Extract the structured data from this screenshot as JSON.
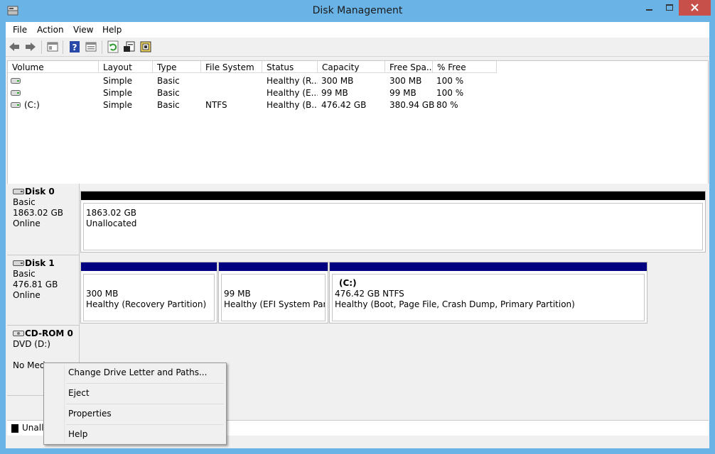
{
  "window": {
    "title": "Disk Management",
    "icon": "disk-management-icon"
  },
  "menu": [
    "File",
    "Action",
    "View",
    "Help"
  ],
  "toolbar": {
    "buttons": [
      "back-icon",
      "forward-icon",
      "console-tree-icon",
      "help-icon",
      "properties-list-icon",
      "refresh-icon",
      "properties-icon",
      "rescan-disks-icon"
    ]
  },
  "volume_list": {
    "columns": [
      "Volume",
      "Layout",
      "Type",
      "File System",
      "Status",
      "Capacity",
      "Free Spa...",
      "% Free"
    ],
    "rows": [
      {
        "volume": "",
        "layout": "Simple",
        "type": "Basic",
        "fs": "",
        "status": "Healthy (R...",
        "capacity": "300 MB",
        "free": "300 MB",
        "pct": "100 %"
      },
      {
        "volume": "",
        "layout": "Simple",
        "type": "Basic",
        "fs": "",
        "status": "Healthy (E...",
        "capacity": "99 MB",
        "free": "99 MB",
        "pct": "100 %"
      },
      {
        "volume": "(C:)",
        "layout": "Simple",
        "type": "Basic",
        "fs": "NTFS",
        "status": "Healthy (B...",
        "capacity": "476.42 GB",
        "free": "380.94 GB",
        "pct": "80 %"
      }
    ]
  },
  "disks": [
    {
      "name": "Disk 0",
      "type": "Basic",
      "size": "1863.02 GB",
      "state": "Online",
      "partitions": [
        {
          "line1": "",
          "line2": "1863.02 GB",
          "line3": "Unallocated",
          "bar": "#000000"
        }
      ]
    },
    {
      "name": "Disk 1",
      "type": "Basic",
      "size": "476.81 GB",
      "state": "Online",
      "partitions": [
        {
          "line1": "",
          "line2": "300 MB",
          "line3": "Healthy (Recovery Partition)",
          "bar": "#000080"
        },
        {
          "line1": "",
          "line2": "99 MB",
          "line3": "Healthy (EFI System Partitio",
          "bar": "#000080"
        },
        {
          "line1": "(C:)",
          "line2": "476.42 GB NTFS",
          "line3": "Healthy (Boot, Page File, Crash Dump, Primary Partition)",
          "bar": "#000080"
        }
      ]
    },
    {
      "name": "CD-ROM 0",
      "type": "DVD (D:)",
      "size": "",
      "state": "No Med"
    }
  ],
  "legend": {
    "label": "Unallo",
    "color": "#000000"
  },
  "context_menu": [
    "Change Drive Letter and Paths...",
    "Eject",
    "Properties",
    "Help"
  ]
}
